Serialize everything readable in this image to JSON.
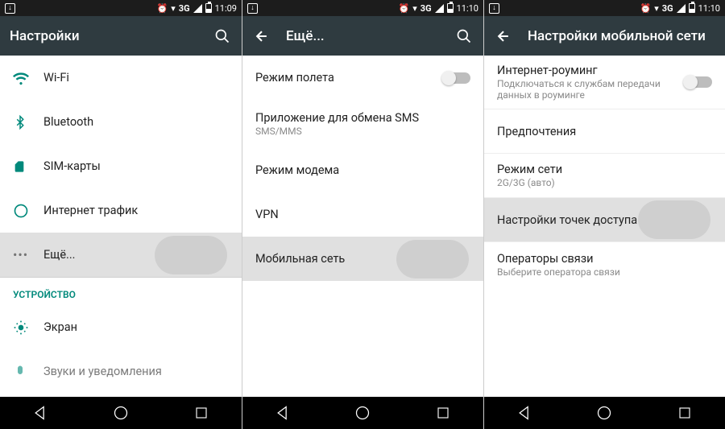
{
  "screen1": {
    "status": {
      "time": "11:09",
      "net": "3G"
    },
    "title": "Настройки",
    "items": [
      {
        "label": "Wi-Fi",
        "icon": "wifi"
      },
      {
        "label": "Bluetooth",
        "icon": "bluetooth"
      },
      {
        "label": "SIM-карты",
        "icon": "sim"
      },
      {
        "label": "Интернет трафик",
        "icon": "data"
      },
      {
        "label": "Ещё...",
        "icon": "more",
        "highlight": true
      }
    ],
    "section": "УСТРОЙСТВО",
    "device_items": [
      {
        "label": "Экран",
        "icon": "display"
      },
      {
        "label": "Звуки и уведомления",
        "icon": "sound"
      }
    ]
  },
  "screen2": {
    "status": {
      "time": "11:10",
      "net": "3G"
    },
    "title": "Ещё...",
    "items": [
      {
        "label": "Режим полета",
        "toggle": true
      },
      {
        "label": "Приложение для обмена SMS",
        "sub": "SMS/MMS"
      },
      {
        "label": "Режим модема"
      },
      {
        "label": "VPN"
      },
      {
        "label": "Мобильная сеть",
        "highlight": true
      }
    ]
  },
  "screen3": {
    "status": {
      "time": "11:10",
      "net": "3G"
    },
    "title": "Настройки мобильной сети",
    "items": [
      {
        "label": "Интернет-роуминг",
        "sub": "Подключаться к службам передачи данных в роуминге",
        "toggle": true
      },
      {
        "label": "Предпочтения"
      },
      {
        "label": "Режим сети",
        "sub": "2G/3G (авто)"
      },
      {
        "label": "Настройки точек доступа",
        "highlight": true
      },
      {
        "label": "Операторы связи",
        "sub": "Выберите оператора связи"
      }
    ]
  }
}
